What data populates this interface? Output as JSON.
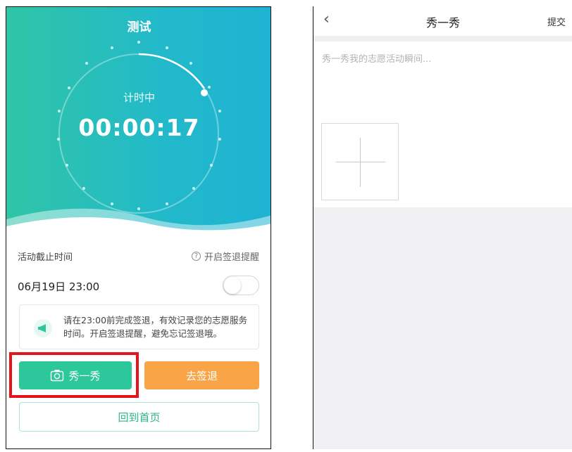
{
  "left_screen": {
    "title": "测试",
    "timer": {
      "status": "计时中",
      "elapsed": "00:00:17"
    },
    "deadline": {
      "label": "活动截止时间",
      "value": "06月19日 23:00"
    },
    "reminder": {
      "label": "开启签退提醒",
      "enabled": false
    },
    "notice": {
      "text": "请在23:00前完成签退，有效记录您的志愿服务时间。开启签退提醒，避免忘记签退哦。"
    },
    "buttons": {
      "show": "秀一秀",
      "signout": "去签退",
      "home": "回到首页"
    },
    "colors": {
      "accent_green": "#2cc79b",
      "accent_orange": "#f9a547",
      "highlight_red": "#e5141a"
    }
  },
  "right_screen": {
    "back_icon": "chevron-left-icon",
    "title": "秀一秀",
    "submit": "提交",
    "placeholder": "秀一秀我的志愿活动瞬间...",
    "add_icon": "plus-icon"
  }
}
